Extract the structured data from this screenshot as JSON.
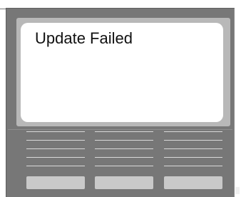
{
  "screen": {
    "status_message": "Update Failed"
  },
  "colors": {
    "device_body": "#777777",
    "screen_bezel": "#b8b8b8",
    "screen_background": "#ffffff",
    "menu_lines": "#d9d9d9",
    "soft_keys": "#c9c9c9"
  },
  "soft_keys": [
    {
      "label": ""
    },
    {
      "label": ""
    },
    {
      "label": ""
    }
  ]
}
